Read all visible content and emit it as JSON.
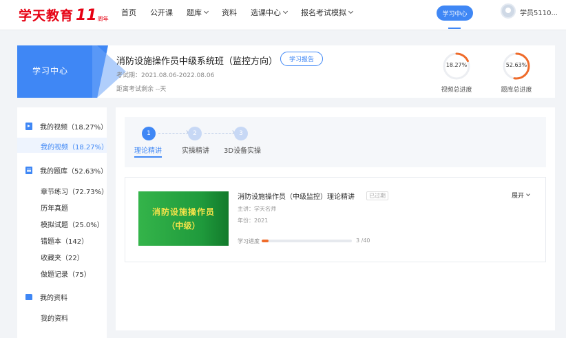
{
  "brand": {
    "name": "学天教育",
    "num": "11",
    "sub": "周年"
  },
  "nav": {
    "items": [
      {
        "label": "首页",
        "dropdown": false
      },
      {
        "label": "公开课",
        "dropdown": false
      },
      {
        "label": "题库",
        "dropdown": true
      },
      {
        "label": "资料",
        "dropdown": false
      },
      {
        "label": "选课中心",
        "dropdown": true
      },
      {
        "label": "报名考试模拟",
        "dropdown": true
      }
    ],
    "study_center": "学习中心",
    "username": "学员5110..."
  },
  "course": {
    "section_label": "学习中心",
    "title": "消防设施操作员中级系统班（监控方向）",
    "report_button": "学习报告",
    "exam_period": "考试期：2021.08.06-2022.08.06",
    "days_left": "距离考试剩余 --天",
    "video_progress": {
      "value": "18.27%",
      "label": "视频总进度",
      "fraction": 0.1827
    },
    "question_progress": {
      "value": "52.63%",
      "label": "题库总进度",
      "fraction": 0.5263
    }
  },
  "sidebar": {
    "groups": [
      {
        "label": "我的视频（18.27%）",
        "icon": "play-icon",
        "items": [
          "我的视频（18.27%）"
        ]
      },
      {
        "label": "我的题库（52.63%）",
        "icon": "document-icon",
        "items": [
          "章节练习（72.73%）",
          "历年真题",
          "模拟试题（25.0%）",
          "错题本（142）",
          "收藏夹（22）",
          "做题记录（75）"
        ]
      },
      {
        "label": "我的资料",
        "icon": "folder-icon",
        "items": [
          "我的资料"
        ]
      }
    ]
  },
  "steps": [
    {
      "num": "1",
      "label": "理论精讲",
      "active": true
    },
    {
      "num": "2",
      "label": "实操精讲",
      "active": false
    },
    {
      "num": "3",
      "label": "3D设备实操",
      "active": false
    }
  ],
  "course_card": {
    "cover_line1": "消防设施操作员",
    "cover_line2": "（中级）",
    "title": "消防设施操作员（中级监控）理论精讲",
    "tag": "已过期",
    "expand": "展开",
    "teacher": "主讲：学天名师",
    "year": "年份：2021",
    "progress_label": "学习进度",
    "progress_count": "3 /40",
    "progress_fraction": 0.075
  },
  "colors": {
    "accent": "#3f87f5",
    "orange": "#ef6b2a",
    "brand_red": "#e60012"
  }
}
